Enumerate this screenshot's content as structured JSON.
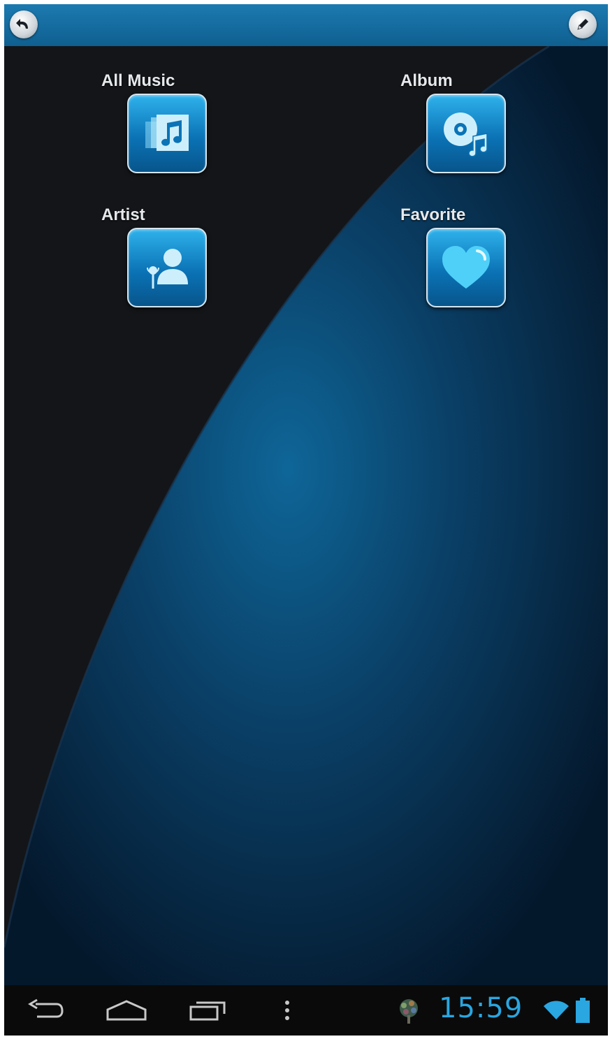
{
  "header": {
    "back_icon": "back-arrow-icon",
    "edit_icon": "pencil-icon"
  },
  "menu": {
    "tiles": [
      {
        "label": "All Music",
        "icon": "music-library-icon"
      },
      {
        "label": "Album",
        "icon": "album-disc-icon"
      },
      {
        "label": "Artist",
        "icon": "artist-microphone-icon"
      },
      {
        "label": "Favorite",
        "icon": "heart-icon"
      }
    ]
  },
  "navbar": {
    "back_icon": "nav-back-icon",
    "home_icon": "nav-home-icon",
    "recents_icon": "nav-recents-icon",
    "overflow_icon": "overflow-menu-icon",
    "notification_icon": "app-notification-icon",
    "time": "15:59",
    "wifi_icon": "wifi-icon",
    "battery_icon": "battery-icon"
  },
  "colors": {
    "accent": "#1c7ab0",
    "tile": "#1a94d4",
    "clock": "#2aa6e0",
    "background_dark": "#131518",
    "background_blue": "#0d5a86"
  }
}
